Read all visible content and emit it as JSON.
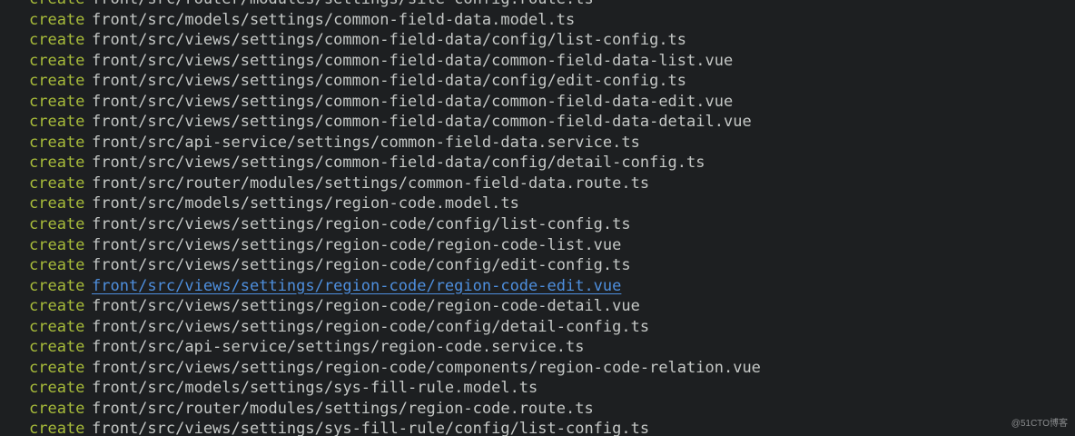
{
  "terminal": {
    "lines": [
      {
        "keyword": "create",
        "path": "front/src/router/modules/settings/site-config.route.ts"
      },
      {
        "keyword": "create",
        "path": "front/src/models/settings/common-field-data.model.ts"
      },
      {
        "keyword": "create",
        "path": "front/src/views/settings/common-field-data/config/list-config.ts"
      },
      {
        "keyword": "create",
        "path": "front/src/views/settings/common-field-data/common-field-data-list.vue"
      },
      {
        "keyword": "create",
        "path": "front/src/views/settings/common-field-data/config/edit-config.ts"
      },
      {
        "keyword": "create",
        "path": "front/src/views/settings/common-field-data/common-field-data-edit.vue"
      },
      {
        "keyword": "create",
        "path": "front/src/views/settings/common-field-data/common-field-data-detail.vue"
      },
      {
        "keyword": "create",
        "path": "front/src/api-service/settings/common-field-data.service.ts"
      },
      {
        "keyword": "create",
        "path": "front/src/views/settings/common-field-data/config/detail-config.ts"
      },
      {
        "keyword": "create",
        "path": "front/src/router/modules/settings/common-field-data.route.ts"
      },
      {
        "keyword": "create",
        "path": "front/src/models/settings/region-code.model.ts"
      },
      {
        "keyword": "create",
        "path": "front/src/views/settings/region-code/config/list-config.ts"
      },
      {
        "keyword": "create",
        "path": "front/src/views/settings/region-code/region-code-list.vue"
      },
      {
        "keyword": "create",
        "path": "front/src/views/settings/region-code/config/edit-config.ts"
      },
      {
        "keyword": "create",
        "path": "front/src/views/settings/region-code/region-code-edit.vue",
        "link": true
      },
      {
        "keyword": "create",
        "path": "front/src/views/settings/region-code/region-code-detail.vue"
      },
      {
        "keyword": "create",
        "path": "front/src/views/settings/region-code/config/detail-config.ts"
      },
      {
        "keyword": "create",
        "path": "front/src/api-service/settings/region-code.service.ts"
      },
      {
        "keyword": "create",
        "path": "front/src/views/settings/region-code/components/region-code-relation.vue"
      },
      {
        "keyword": "create",
        "path": "front/src/models/settings/sys-fill-rule.model.ts"
      },
      {
        "keyword": "create",
        "path": "front/src/router/modules/settings/region-code.route.ts"
      },
      {
        "keyword": "create",
        "path": "front/src/views/settings/sys-fill-rule/config/list-config.ts"
      }
    ]
  },
  "watermark": "@51CTO博客",
  "colors": {
    "background": "#1d1f21",
    "keyword": "#a8bc3a",
    "path": "#c5c8c6",
    "link": "#4e8fde"
  }
}
